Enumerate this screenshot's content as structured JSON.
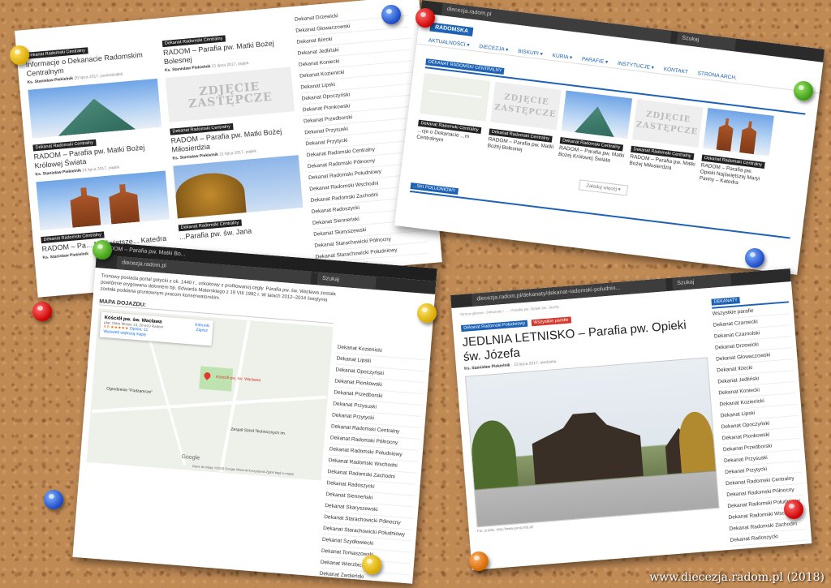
{
  "caption": "www.diecezja.radom.pl (2018)",
  "card1": {
    "tag": "Dekanat Radomski Centralny",
    "posts": [
      {
        "tag": "Dekanat Radomski Centralny",
        "title": "Informacje o Dekanacie Radomskim Centralnym",
        "author": "Ks. Stanisław Piekielnik",
        "date": "20 lipca 2017, poniedziałek"
      },
      {
        "tag": "Dekanat Radomski Centralny",
        "title": "RADOM – Parafia pw. Matki Bożej Bolesnej",
        "author": "Ks. Stanisław Piekielnik",
        "date": "21 lipca 2017, piątek"
      },
      {
        "tag": "Dekanat Radomski Centralny",
        "title": "RADOM – Parafia pw. Matki Bożej Królowej Świata",
        "author": "Ks. Stanisław Piekielnik",
        "date": "21 lipca 2017, piątek"
      },
      {
        "tag": "Dekanat Radomski Centralny",
        "title": "RADOM – Parafia pw. Matki Bożej Miłosierdzia",
        "author": "Ks. Stanisław Piekielnik",
        "date": "21 lipca 2017, piątek"
      },
      {
        "tag": "Dekanat Radomski Centralny",
        "title": "RADOM – Pa... Najświętsze... Katedra",
        "author": "Ks. Stanisław Piekielnik",
        "date": ""
      },
      {
        "tag": "Dekanat Radomski Centralny",
        "title": "...Parafia pw. św. Jana",
        "author": "",
        "date": ""
      }
    ],
    "stamp": "ZDJĘCIE ZASTĘPCZE",
    "sidebar": [
      "Dekanat Drzewicki",
      "Dekanat Głowaczowski",
      "Dekanat Iłżecki",
      "Dekanat Jedliński",
      "Dekanat Koniecki",
      "Dekanat Kozienicki",
      "Dekanat Lipski",
      "Dekanat Opoczyński",
      "Dekanat Pionkowski",
      "Dekanat Przedborski",
      "Dekanat Przysuski",
      "Dekanat Przytycki",
      "Dekanat Radomski Centralny",
      "Dekanat Radomski Północny",
      "Dekanat Radomski Południowy",
      "Dekanat Radomski Wschodni",
      "Dekanat Radomski Zachodni",
      "Dekanat Radoszycki",
      "Dekanat Sienneński",
      "Dekanat Skaryszewski",
      "Dekanat Starachowicki Północny",
      "Dekanat Starachowicki Południowy",
      "Dekanat Szydłowiecki"
    ]
  },
  "card2": {
    "url": "diecezja.radom.pl",
    "logo": "RADOMSKA",
    "nav": [
      "AKTUALNOŚCI ▾",
      "DIECEZJA ▾",
      "BISKUPI ▾",
      "KURIA ▾",
      "PARAFIE ▾",
      "INSTYTUCJE ▾",
      "KONTAKT",
      "STRONA ARCH."
    ],
    "section1": "DEKANAT RADOMSKI CENTRALNY",
    "posts": [
      {
        "tag": "Dekanat Radomski Centralny",
        "title": "...cje o Dekanacie ...m Centralnym"
      },
      {
        "tag": "Dekanat Radomski Centralny",
        "title": "RADOM – Parafia pw. Matki Bożej Bolesnej"
      },
      {
        "tag": "Dekanat Radomski Centralny",
        "title": "RADOM – Parafia pw. Matki Bożej Królowej Świata"
      },
      {
        "tag": "Dekanat Radomski Centralny",
        "title": "RADOM – Parafia pw. Matki Bożej Miłosierdzia"
      },
      {
        "tag": "Dekanat Radomski Centralny",
        "title": "RADOM – Parafia pw. Opieki Najświętszej Maryi Panny – Katedra"
      }
    ],
    "more": "Załaduj więcej ▾",
    "section2": "...SKI POŁUDNIOWY",
    "search": "Szukaj"
  },
  "card3": {
    "tab": "RADOM – Parafia pw. Matki Bo...",
    "url": "diecezja.radom.pl",
    "search": "Szukaj",
    "body": "Tronowy posiada portal gotycki z ok. 1440 r., uskokowy z profilowanej cegły. Parafia pw. św. Wacława została powtórnie erygowana dekretem bp. Edwarda Materskiego z 19 VIII 1992 r. W latach 2012–2014 świątynia została poddana gruntownym pracom konserwatorskim.",
    "map_heading": "MAPA DOJAZDU:",
    "map_place": "Kościół pw. św. Wacława",
    "map_addr": "plac Stare Miasto 13, 26-610 Radom",
    "map_rating": "4.6 ★★★★★",
    "map_reviews": "Opinie: 11",
    "map_larger": "Wyświetl większą mapę",
    "map_btn1": "Kierunki",
    "map_btn2": "Zapisz",
    "map_pin_label": "Kościół pw. św. Wacława",
    "map_label2": "Ogrodzenie \"Podzamcze\"",
    "map_label3": "Zespół Szkół Technicznych im.",
    "map_footer": "Dane do Mapy ©2018 Google  Warunki korzystania  Zgłoś błąd w mapie",
    "google": "Google",
    "sidebar": [
      "Dekanat Kozienicki",
      "Dekanat Lipski",
      "Dekanat Opoczyński",
      "Dekanat Pionkowski",
      "Dekanat Przedborski",
      "Dekanat Przysuski",
      "Dekanat Przytycki",
      "Dekanat Radomski Centralny",
      "Dekanat Radomski Północny",
      "Dekanat Radomski Południowy",
      "Dekanat Radomski Wschodni",
      "Dekanat Radomski Zachodni",
      "Dekanat Radoszycki",
      "Dekanat Sienneński",
      "Dekanat Skaryszewski",
      "Dekanat Starachowicki Północny",
      "Dekanat Starachowicki Południowy",
      "Dekanat Szydłowiecki",
      "Dekanat Tomaszowski",
      "Dekanat Wierzbicki",
      "Dekanat Zwoleński",
      "Dekanat Żarnowski"
    ]
  },
  "card4": {
    "url": "diecezja.radom.pl/dekanaty/dekanat-radomski-poludnio...",
    "search": "Szukaj",
    "breadcrumb": "Strona główna › Dekanaty › ... › Parafia pw. Opieki św. Józefa",
    "tag1": "Dekanat Radomski Południowy",
    "tag2": "Wszystkie parafie",
    "title": "JEDLNIA LETNISKO – Parafia pw. Opieki św. Józefa",
    "author": "Ks. Stanisław Piekielnik",
    "date": "23 lipca 2017, niedziela",
    "photo_caption": "Fot. źródło: http://www.jomij.info.pl/",
    "sidebar_title": "DEKANATY",
    "sidebar": [
      "Wszystkie parafie",
      "Dekanat Czarnecki",
      "Dekanat Czarnolski",
      "Dekanat Drzewicki",
      "Dekanat Głowaczowski",
      "Dekanat Iłżecki",
      "Dekanat Jedliński",
      "Dekanat Koniecki",
      "Dekanat Kozienicki",
      "Dekanat Lipski",
      "Dekanat Opoczyński",
      "Dekanat Pionkowski",
      "Dekanat Przedborski",
      "Dekanat Przysuski",
      "Dekanat Przytycki",
      "Dekanat Radomski Centralny",
      "Dekanat Radomski Północny",
      "Dekanat Radomski Południowy",
      "Dekanat Radomski Wschodni",
      "Dekanat Radomski Zachodni",
      "Dekanat Radoszycki"
    ]
  }
}
